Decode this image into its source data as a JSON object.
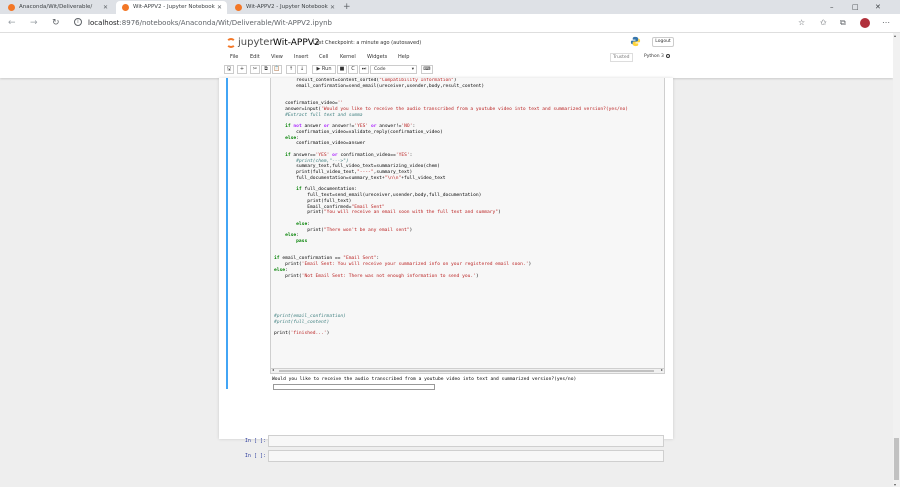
{
  "browser": {
    "tabs": [
      {
        "title": "Anaconda/Wit/Deliverable/",
        "favicon_color": "#f37726"
      },
      {
        "title": "Wit-APPV2 - Jupyter Notebook",
        "favicon_color": "#f37726"
      },
      {
        "title": "Wit-APPV2 - Jupyter Notebook",
        "favicon_color": "#f37726"
      }
    ],
    "new_tab_symbol": "+",
    "window_controls": [
      "–",
      "□",
      "✕"
    ],
    "url_host": "localhost",
    "url_path": ":8976/notebooks/Anaconda/Wit/Deliverable/Wit-APPV2.ipynb",
    "avatar_color": "#b0303b"
  },
  "jupyter": {
    "logo_text": "jupyter",
    "notebook_name": "Wit-APPV2",
    "checkpoint": "Last Checkpoint: a minute ago  (autosaved)",
    "logout_label": "Logout",
    "trusted_label": "Trusted",
    "kernel_label": "Python 3",
    "menu": [
      "File",
      "Edit",
      "View",
      "Insert",
      "Cell",
      "Kernel",
      "Widgets",
      "Help"
    ],
    "toolbar": {
      "save": "🖫",
      "insert": "+",
      "cut": "✂",
      "copy": "⧉",
      "paste": "📋",
      "move_up": "↑",
      "move_down": "↓",
      "run": "▶ Run",
      "stop": "■",
      "restart": "C",
      "restart_run": "⏭",
      "keyboard": "⌨"
    },
    "cell_type": "Code"
  },
  "cells": {
    "output_prompt": "Would you like to receive the audio transcribed from a youtube video into text and summarized version?(yes/no)",
    "empty_prompt_1": "In [ ]:",
    "empty_prompt_2": "In [ ]:"
  },
  "accent_color": "#42a5f5"
}
